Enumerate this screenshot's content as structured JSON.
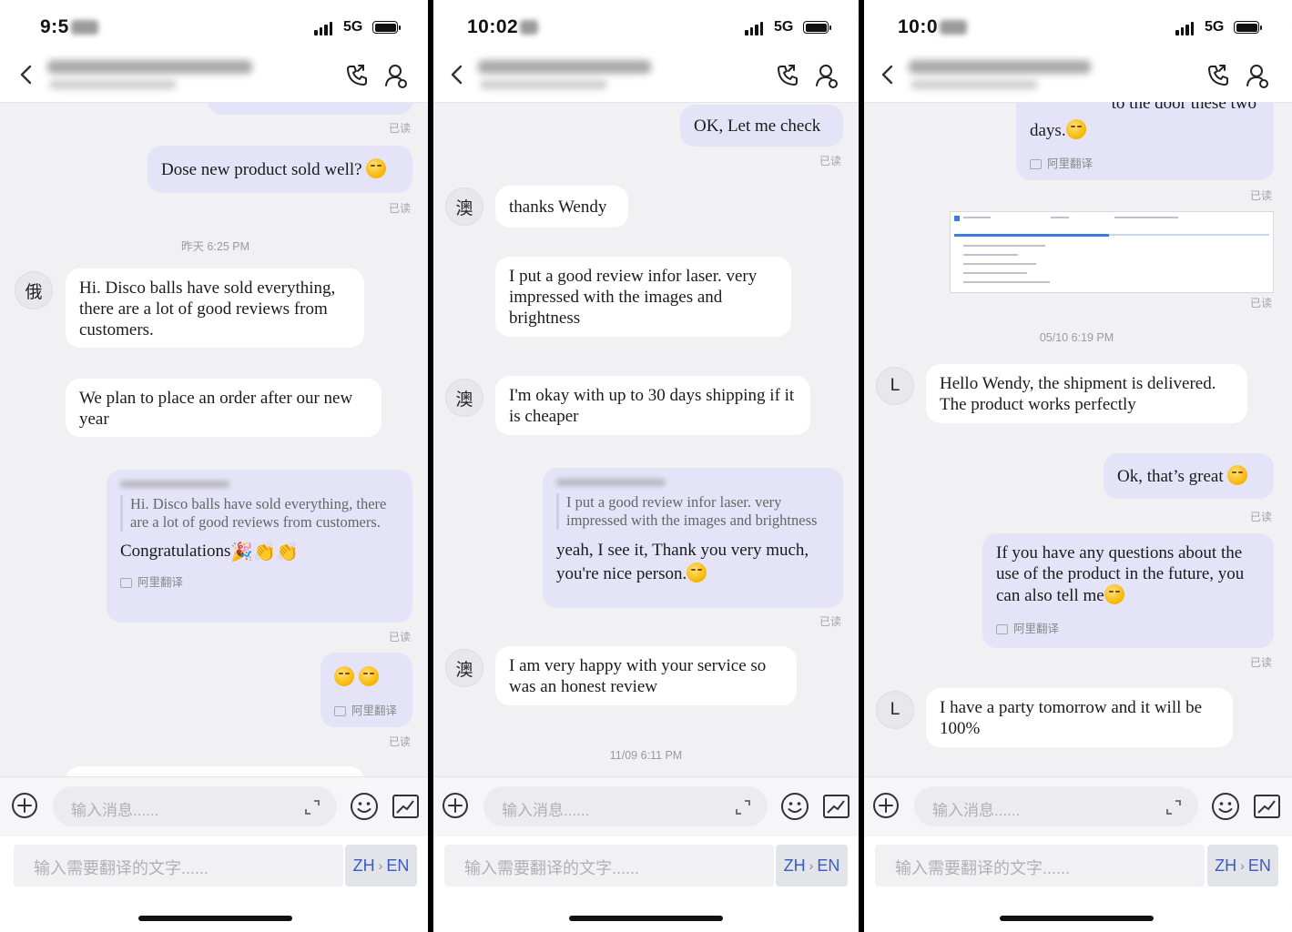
{
  "common": {
    "network": "5G",
    "read_label": "已读",
    "translate_tag": "阿里翻译",
    "input_placeholder": "输入消息......",
    "translate_placeholder": "输入需要翻译的文字......",
    "lang_from": "ZH",
    "lang_to": "EN",
    "lang_arrow": "›"
  },
  "phone1": {
    "time": "9:5",
    "out1": "Dose new product sold well?",
    "stamp1": "昨天 6:25 PM",
    "avatar": "俄",
    "in1": "Hi. Disco balls have sold everything, there are a lot of good reviews from customers.",
    "in2": "We plan to place an order after our new year",
    "quote": "Hi. Disco balls have sold everything, there are a lot of good reviews from customers.",
    "reply": "Congratulations"
  },
  "phone2": {
    "time": "10:02",
    "out1": "OK, Let me check",
    "avatar": "澳",
    "in1": "thanks Wendy",
    "in2": "I put a good review infor laser.  very impressed with the images and brightness",
    "in3": "I'm okay with up to 30 days shipping if it is cheaper",
    "quote": "I put a good review infor laser.  very impressed with the images and brightness",
    "reply": "yeah, I see it, Thank you very much, you're nice person.",
    "in4": "I am very happy with your service so was an honest review",
    "stamp1": "11/09 6:11 PM"
  },
  "phone3": {
    "time": "10:0",
    "out_top_a": "to the door these two",
    "out_top_b": "days.",
    "stamp1": "05/10 6:19 PM",
    "avatar": "L",
    "in1": "Hello Wendy, the shipment is delivered. The product works perfectly",
    "out1": "Ok, that’s great",
    "out2": "If you have any questions about the use of the product in the future, you can also tell me",
    "in2": "I have a party tomorrow and it will be 100%"
  }
}
